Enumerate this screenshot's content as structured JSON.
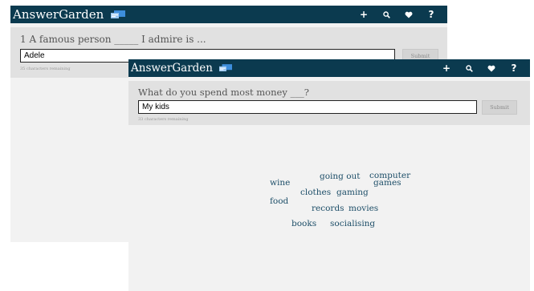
{
  "back_window": {
    "brand": "AnswerGarden",
    "question": "1 A famous person _____ I admire is ...",
    "answer_value": "Adele",
    "submit_label": "Submit",
    "chars_remaining": "35 characters remaining"
  },
  "front_window": {
    "brand": "AnswerGarden",
    "question": "What do you spend most money ___?",
    "answer_value": "My kids",
    "submit_label": "Submit",
    "chars_remaining": "33 characters remaining",
    "words": [
      {
        "text": "going out"
      },
      {
        "text": "computer"
      },
      {
        "text": "games"
      },
      {
        "text": "wine"
      },
      {
        "text": "clothes"
      },
      {
        "text": "gaming"
      },
      {
        "text": "food"
      },
      {
        "text": "records"
      },
      {
        "text": "movies"
      },
      {
        "text": "books"
      },
      {
        "text": "socialising"
      }
    ]
  },
  "toolbar": {
    "add_label": "+",
    "help_label": "?"
  },
  "icons": {
    "brand": "chat-bubble-icon",
    "add": "plus-icon",
    "search": "search-icon",
    "favorite": "heart-icon",
    "help": "question-icon"
  },
  "colors": {
    "topbar": "#0b3a4f",
    "brand_icon": "#3d8edc",
    "panel": "#f2f2f2",
    "question_area": "#e1e1e1",
    "word": "#1d4e68"
  }
}
